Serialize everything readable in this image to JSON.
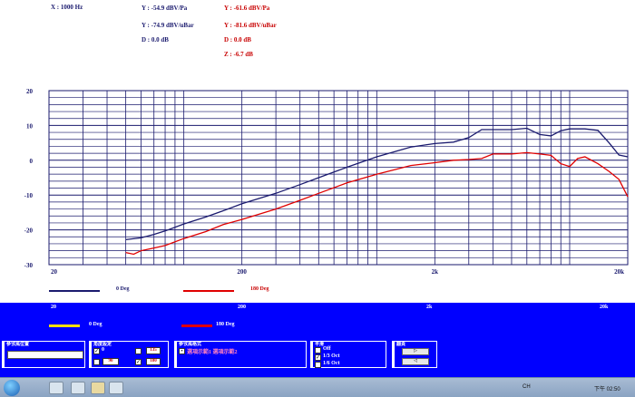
{
  "readouts": {
    "x_freq": "X : 1000 Hz",
    "navy_y1": "Y : -54.9 dBV/Pa",
    "navy_y2": "Y : -74.9 dBV/uBar",
    "navy_d": "D : 0.0 dB",
    "red_y1": "Y : -61.6 dBV/Pa",
    "red_y2": "Y : -81.6 dBV/uBar",
    "red_d": "D : 0.0 dB",
    "red_z": "Z : -6.7 dB"
  },
  "colors": {
    "series_0": "#1a1a6e",
    "series_180": "#e00000",
    "grid": "#1a1a6e",
    "panel": "#0000ff",
    "legend_yellow": "#ffe000"
  },
  "chart_data": {
    "type": "line",
    "xscale": "log",
    "xlim": [
      20,
      20000
    ],
    "ylim": [
      -30,
      20
    ],
    "yticks": [
      "20",
      "10",
      "0",
      "-10",
      "-20",
      "-30"
    ],
    "xticks": [
      "20",
      "200",
      "2k",
      "20k"
    ],
    "grid": true,
    "series": [
      {
        "name": "0 Deg",
        "x": [
          50,
          60,
          70,
          80,
          100,
          130,
          160,
          200,
          300,
          400,
          500,
          700,
          1000,
          1500,
          2000,
          2500,
          3000,
          3500,
          4000,
          5000,
          6000,
          7000,
          8000,
          9000,
          10000,
          12000,
          14000,
          16000,
          18000,
          20000
        ],
        "y": [
          -22.8,
          -22.3,
          -21.3,
          -20.3,
          -18.3,
          -16.3,
          -14.5,
          -12.5,
          -9.5,
          -7,
          -5,
          -2,
          1,
          3.8,
          4.8,
          5.2,
          6.5,
          8.8,
          8.8,
          8.8,
          9.2,
          7.4,
          7,
          8.5,
          9,
          9,
          8.6,
          5,
          1.5,
          1
        ]
      },
      {
        "name": "180 Deg",
        "x": [
          50,
          55,
          60,
          70,
          80,
          100,
          130,
          160,
          200,
          300,
          400,
          500,
          700,
          1000,
          1500,
          2000,
          2500,
          3000,
          3500,
          4000,
          5000,
          6000,
          7000,
          8000,
          9000,
          10000,
          11000,
          12000,
          14000,
          16000,
          18000,
          20000
        ],
        "y": [
          -26.5,
          -27,
          -26,
          -25.2,
          -24.5,
          -22.5,
          -20.5,
          -18.5,
          -17,
          -14,
          -11.5,
          -9.5,
          -6.5,
          -4,
          -1.5,
          -0.7,
          0,
          0.2,
          0.5,
          1.8,
          1.8,
          2.2,
          1.8,
          1.4,
          -1,
          -1.8,
          0.5,
          1,
          -1,
          -3.2,
          -5.5,
          -10.5
        ]
      }
    ]
  },
  "legend_top": [
    {
      "label": "0 Deg"
    },
    {
      "label": "180 Deg"
    }
  ],
  "secondary_axis_ticks": [
    "20",
    "200",
    "2k",
    "20k"
  ],
  "legend_bottom": [
    {
      "label": "0 Deg"
    },
    {
      "label": "180 Deg"
    }
  ],
  "controls": {
    "reference_position_title": "參攷風位置",
    "angle_title": "角度設定",
    "angle_values": [
      "0",
      "135",
      "90",
      "180"
    ],
    "reference_mode_title": "參攷風格式",
    "reference_mode_option": "選項示範1 選項示範2",
    "smoothing_title": "平滑",
    "smoothing_options": [
      "Off",
      "1/3 Oct",
      "1/6 Oct"
    ],
    "nav_title": "翻頁",
    "nav_forward": "▷",
    "nav_back": "◁"
  },
  "taskbar": {
    "lang": "CH",
    "time": "下午 02:50"
  }
}
